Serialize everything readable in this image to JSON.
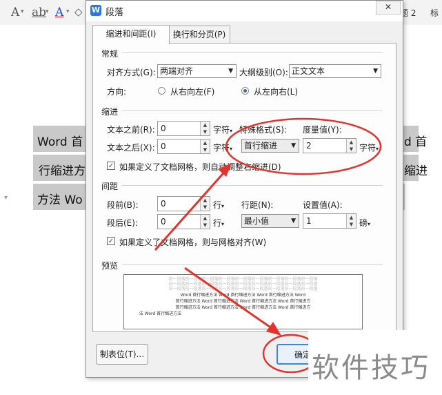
{
  "background": {
    "ribbon": {
      "icons": [
        "font-color-icon",
        "strikethrough-icon",
        "font-color-a-icon",
        "clear-format-icon"
      ],
      "heading_label": "题 2",
      "top_right_label": "标"
    },
    "document": {
      "line1_left": "Word 首",
      "line1_right": "d 首",
      "line2_left": "行缩进方",
      "line2_right": "缩进",
      "line3_left": "方法 Wo"
    }
  },
  "dialog": {
    "title": "段落",
    "app_icon_letter": "W",
    "close_glyph": "✕",
    "tabs": [
      {
        "label": "缩进和间距(I)",
        "active": true
      },
      {
        "label": "换行和分页(P)",
        "active": false
      }
    ],
    "general": {
      "heading": "常规",
      "alignment_label": "对齐方式(G):",
      "alignment_value": "两端对齐",
      "outline_label": "大纲级别(O):",
      "outline_value": "正文文本",
      "direction_label": "方向:",
      "rtl_label": "从右向左(F)",
      "ltr_label": "从左向右(L)",
      "direction_selected": "从左向右(L)"
    },
    "indent": {
      "heading": "缩进",
      "before_label": "文本之前(R):",
      "before_value": "0",
      "before_unit": "字符",
      "after_label": "文本之后(X):",
      "after_value": "0",
      "after_unit": "字符",
      "special_label": "特殊格式(S):",
      "special_value": "首行缩进",
      "measure_label": "度量值(Y):",
      "measure_value": "2",
      "measure_unit": "字符",
      "grid_checkbox": "如果定义了文档网格，则自动调整右缩进(D)",
      "grid_checked": true
    },
    "spacing": {
      "heading": "间距",
      "before_label": "段前(B):",
      "before_value": "0",
      "before_unit": "行",
      "after_label": "段后(E):",
      "after_value": "0",
      "after_unit": "行",
      "line_label": "行距(N):",
      "line_value": "最小值",
      "setting_label": "设置值(A):",
      "setting_value": "1",
      "setting_unit": "磅",
      "grid_checkbox": "如果定义了文档网格，则与网格对齐(W)",
      "grid_checked": true
    },
    "preview": {
      "heading": "预览",
      "prev_line": "前一段落前一段落前一段落前一段落前一段落前一段落前一段落前一段落前一段落",
      "body_line1": "Word 首行缩进方法 Word 首行缩进方法 Word 首行缩进方法 Word",
      "body_line2": "首行缩进方法 Word 首行缩进方法 Word 首行缩进方法 Word 首行缩进方",
      "body_line3": "法 Word 首行缩进方法"
    },
    "buttons": {
      "tabs_button": "制表位(T)...",
      "ok_button": "确定"
    }
  },
  "annotations": {
    "color": "#e2332c"
  },
  "watermark": "软件技巧"
}
